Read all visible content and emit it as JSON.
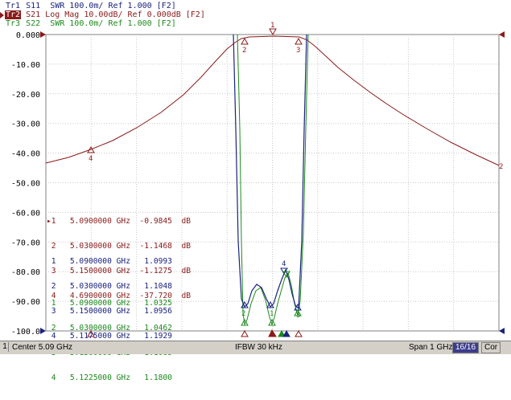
{
  "traces": [
    {
      "id": "Tr1",
      "text": "S11  SWR 100.0m/ Ref 1.000 [F2]",
      "color": "#1a237e"
    },
    {
      "id": "Tr2",
      "text": "S21 Log Mag 10.00dB/ Ref 0.000dB [F2]",
      "color": "#8b1a1a"
    },
    {
      "id": "Tr3",
      "text": "S22  SWR 100.0m/ Ref 1.000 [F2]",
      "color": "#1b8a1b"
    }
  ],
  "y_axis_labels": [
    "0.000",
    "-10.00",
    "-20.00",
    "-30.00",
    "-40.00",
    "-50.00",
    "-60.00",
    "-70.00",
    "-80.00",
    "-90.00",
    "-100.0"
  ],
  "marker_tables": {
    "tr2": [
      "▸1   5.0900000 GHz  -0.9845  dB",
      " 2   5.0300000 GHz  -1.1468  dB",
      " 3   5.1500000 GHz  -1.1275  dB",
      " 4   4.6900000 GHz  -37.720  dB"
    ],
    "tr1": [
      " 1   5.0900000 GHz   1.0993",
      " 2   5.0300000 GHz   1.1048",
      " 3   5.1500000 GHz   1.0956",
      " 4   5.1175000 GHz   1.1929"
    ],
    "tr3": [
      " 1   5.0900000 GHz   1.0325",
      " 2   5.0300000 GHz   1.0462",
      " 3   5.1500000 GHz   1.1069",
      " 4   5.1225000 GHz   1.1800"
    ]
  },
  "markers": {
    "tr2": [
      {
        "label": "1",
        "freq_ghz": 5.09,
        "value": -0.9845
      },
      {
        "label": "2",
        "freq_ghz": 5.03,
        "value": -1.1468
      },
      {
        "label": "3",
        "freq_ghz": 5.15,
        "value": -1.1275
      },
      {
        "label": "4",
        "freq_ghz": 4.69,
        "value": -37.72
      }
    ]
  },
  "right_edge_label": "2",
  "statusbar": {
    "channel": "1",
    "center": "Center 5.09 GHz",
    "ifbw": "IFBW 30 kHz",
    "span": "Span 1 GHz",
    "sweep": "16/16",
    "cor": "Cor"
  },
  "colors": {
    "tr1": "#1a237e",
    "tr2": "#8b1a1a",
    "tr3": "#1b8a1b",
    "grid": "#c8c8c8"
  }
}
